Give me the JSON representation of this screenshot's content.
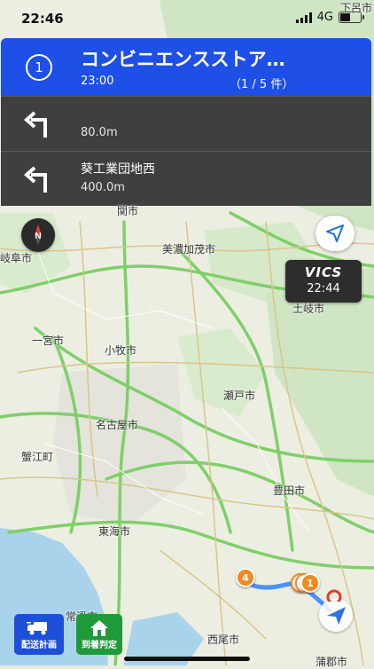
{
  "status_bar": {
    "time": "22:46",
    "network": "4G",
    "battery_level": 0.55
  },
  "nav_panel": {
    "destination_number": "1",
    "destination_name": "コンビニエンスストア…",
    "arrival_time": "23:00",
    "destination_count": "（1 / 5 件）",
    "steps": [
      {
        "street": "",
        "distance": "80.0m",
        "direction": "turn-left"
      },
      {
        "street": "葵工業団地西",
        "distance": "400.0m",
        "direction": "turn-left"
      }
    ]
  },
  "vics": {
    "title": "VICS",
    "time": "22:44"
  },
  "map_labels": {
    "seki": "関市",
    "gifu": "岐阜市",
    "minokamo": "美濃加茂市",
    "toki": "土岐市",
    "ichinomiya": "一宮市",
    "komaki": "小牧市",
    "seto": "瀬戸市",
    "nagoya": "名古屋市",
    "kanie": "蟹江町",
    "toyota": "豊田市",
    "tokai": "東海市",
    "tokoname": "常滑市",
    "nishio": "西尾市",
    "gamagori": "蒲郡市",
    "shimoro": "下呂市"
  },
  "route_pins": [
    {
      "number": "4"
    },
    {
      "number": "1"
    }
  ],
  "bottom_buttons": {
    "plan_label": "配送計画",
    "arrive_label": "到着判定"
  },
  "colors": {
    "nav_blue": "#1e4fe6",
    "nav_dark": "#3f3f3f",
    "route": "#4a90ff",
    "pin": "#f08a20",
    "plan_button": "#1d4fd8",
    "arrive_button": "#1f9a3a"
  }
}
